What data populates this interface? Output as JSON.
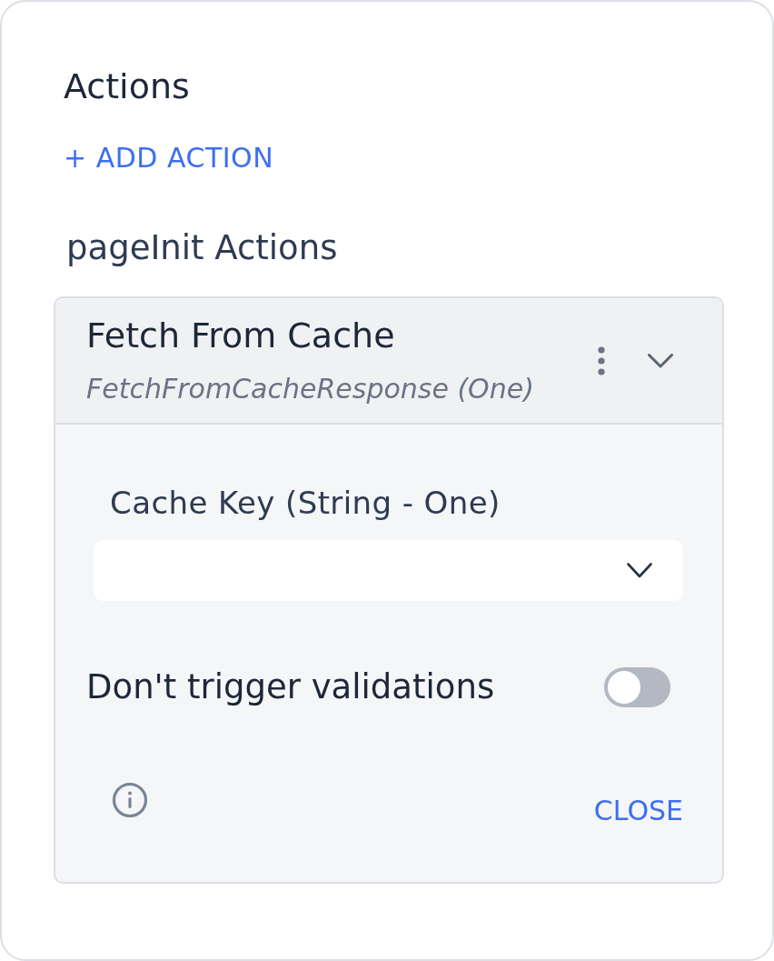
{
  "panel": {
    "title": "Actions",
    "add_button": "+ ADD ACTION",
    "section_title": "pageInit Actions"
  },
  "action": {
    "title": "Fetch From Cache",
    "subtitle": "FetchFromCacheResponse (One)",
    "expanded": true,
    "fields": [
      {
        "kind": "select",
        "label": "Cache Key (String - One)"
      },
      {
        "kind": "toggle",
        "label": "Don't trigger validations",
        "on": false
      }
    ],
    "close_button": "CLOSE"
  }
}
